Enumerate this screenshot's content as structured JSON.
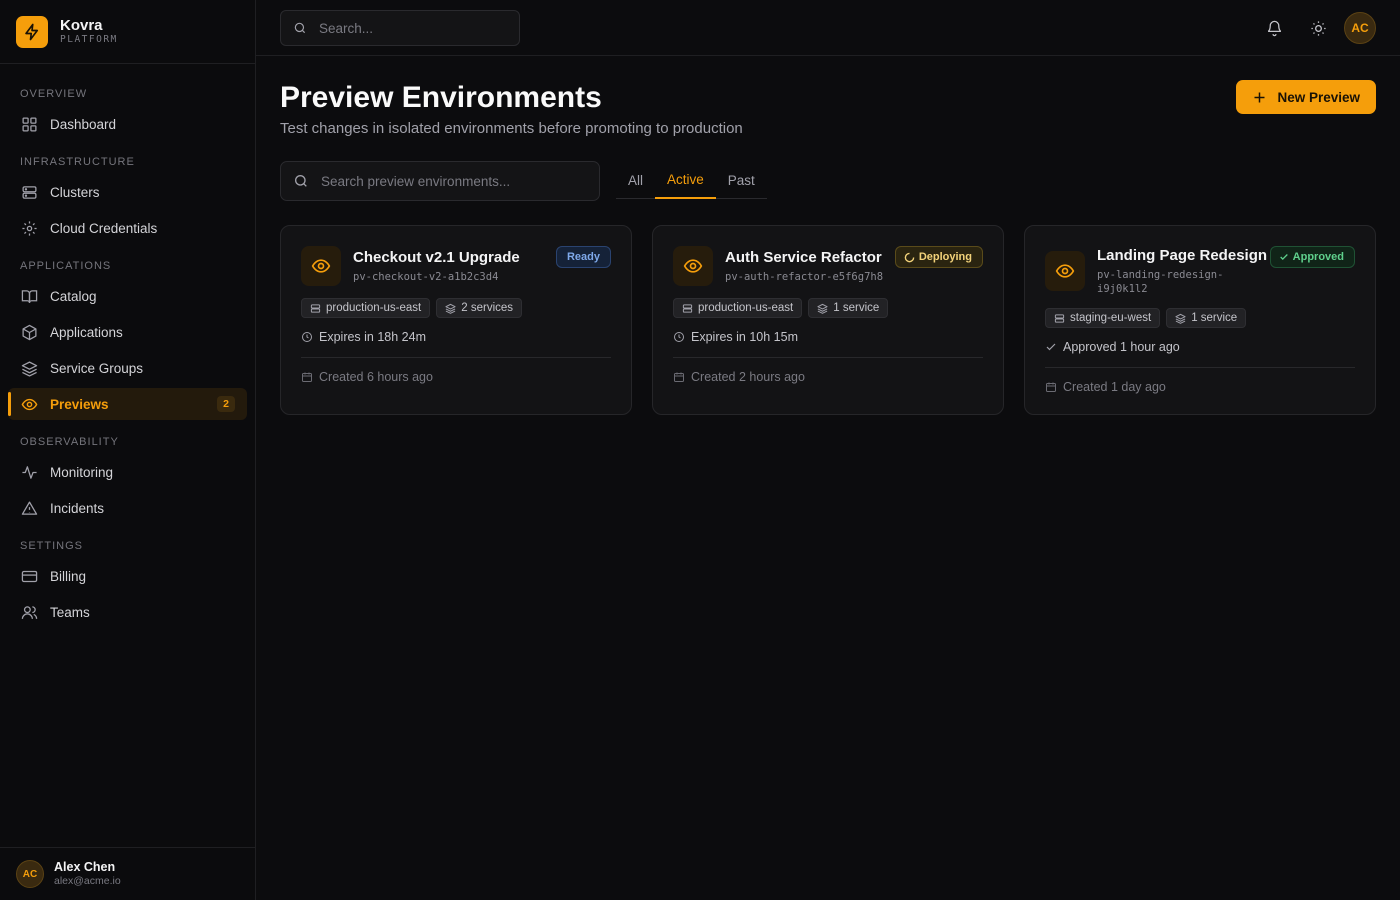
{
  "brand": {
    "name": "Kovra",
    "subtitle": "PLATFORM"
  },
  "sidebar": {
    "sections": [
      "OVERVIEW",
      "INFRASTRUCTURE",
      "APPLICATIONS",
      "OBSERVABILITY",
      "SETTINGS"
    ],
    "items": [
      {
        "label": "Dashboard",
        "icon": "grid-icon"
      },
      {
        "label": "Clusters",
        "icon": "server-icon"
      },
      {
        "label": "Cloud Credentials",
        "icon": "gear-icon"
      },
      {
        "label": "Catalog",
        "icon": "book-icon"
      },
      {
        "label": "Applications",
        "icon": "cube-icon"
      },
      {
        "label": "Service Groups",
        "icon": "layers-icon"
      },
      {
        "label": "Previews",
        "icon": "eye-icon",
        "active": true,
        "badge": "2"
      },
      {
        "label": "Monitoring",
        "icon": "pulse-icon"
      },
      {
        "label": "Incidents",
        "icon": "warning-icon"
      },
      {
        "label": "Billing",
        "icon": "credit-card-icon"
      },
      {
        "label": "Teams",
        "icon": "users-icon"
      }
    ],
    "user": {
      "initials": "AC",
      "name": "Alex Chen",
      "email": "alex@acme.io"
    }
  },
  "topbar": {
    "search_placeholder": "Search...",
    "avatar_initials": "AC"
  },
  "page": {
    "title": "Preview Environments",
    "subtitle": "Test changes in isolated environments before promoting to production",
    "new_button": "New Preview",
    "filter_placeholder": "Search preview environments...",
    "tabs": [
      "All",
      "Active",
      "Past"
    ],
    "active_tab": "Active"
  },
  "cards": [
    {
      "title": "Checkout v2.1 Upgrade",
      "id": "pv-checkout-v2-a1b2c3d4",
      "status": "Ready",
      "cluster": "production-us-east",
      "services": "2 services",
      "line": "Expires in 18h 24m",
      "created": "Created 6 hours ago"
    },
    {
      "title": "Auth Service Refactor",
      "id": "pv-auth-refactor-e5f6g7h8",
      "status": "Deploying",
      "cluster": "production-us-east",
      "services": "1 service",
      "line": "Expires in 10h 15m",
      "created": "Created 2 hours ago"
    },
    {
      "title": "Landing Page Redesign",
      "id_line1": "pv-landing-redesign-",
      "id_line2": "i9j0k1l2",
      "status": "Approved",
      "cluster": "staging-eu-west",
      "services": "1 service",
      "line": "Approved 1 hour ago",
      "created": "Created 1 day ago"
    }
  ],
  "colors": {
    "accent": "#f59e0b",
    "background": "#0c0c0e",
    "card": "#131315"
  }
}
